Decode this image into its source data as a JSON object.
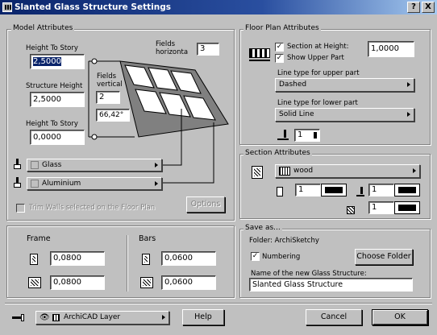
{
  "window": {
    "title": "Slanted Glass Structure Settings",
    "help_btn": "?",
    "close_btn": "X"
  },
  "model_attributes": {
    "title": "Model Attributes",
    "height_to_story_top_label": "Height To Story",
    "height_to_story_top_value": "2,5000",
    "structure_height_label": "Structure Height",
    "structure_height_value": "2,5000",
    "height_to_story_bottom_label": "Height To Story",
    "height_to_story_bottom_value": "0,0000",
    "fields_horizontal_label_1": "Fields",
    "fields_horizontal_label_2": "horizonta",
    "fields_horizontal_value": "3",
    "fields_vertical_label_1": "Fields",
    "fields_vertical_label_2": "vertical",
    "fields_vertical_value": "2",
    "angle_value": "66,42°",
    "material_glass": "Glass",
    "material_aluminium": "Aluminium",
    "trim_walls_label": "Trim Walls selected on the Floor Plan",
    "options_btn": "Options"
  },
  "floor_plan": {
    "title": "Floor Plan Attributes",
    "section_at_height_label": "Section at Height:",
    "section_at_height_value": "1,0000",
    "show_upper_part_label": "Show Upper Part",
    "line_upper_label": "Line type for upper part",
    "line_upper_value": "Dashed",
    "line_lower_label": "Line type for lower part",
    "line_lower_value": "Solid Line",
    "pen_value": "1"
  },
  "section_attributes": {
    "title": "Section Attributes",
    "fill_value": "wood",
    "pen1": "1",
    "pen2": "1",
    "pen3": "1"
  },
  "save_as": {
    "title": "Save as...",
    "folder_label": "Folder: ArchiSketchy",
    "numbering_label": "Numbering",
    "choose_folder_btn": "Choose Folder",
    "name_label": "Name of the new Glass Structure:",
    "name_value": "Slanted Glass Structure"
  },
  "frame": {
    "title": "Frame",
    "value1": "0,0800",
    "value2": "0,0800"
  },
  "bars": {
    "title": "Bars",
    "value1": "0,0600",
    "value2": "0,0600"
  },
  "bottom": {
    "layer_value": "ArchiCAD Layer",
    "help_btn": "Help",
    "cancel_btn": "Cancel",
    "ok_btn": "OK"
  }
}
